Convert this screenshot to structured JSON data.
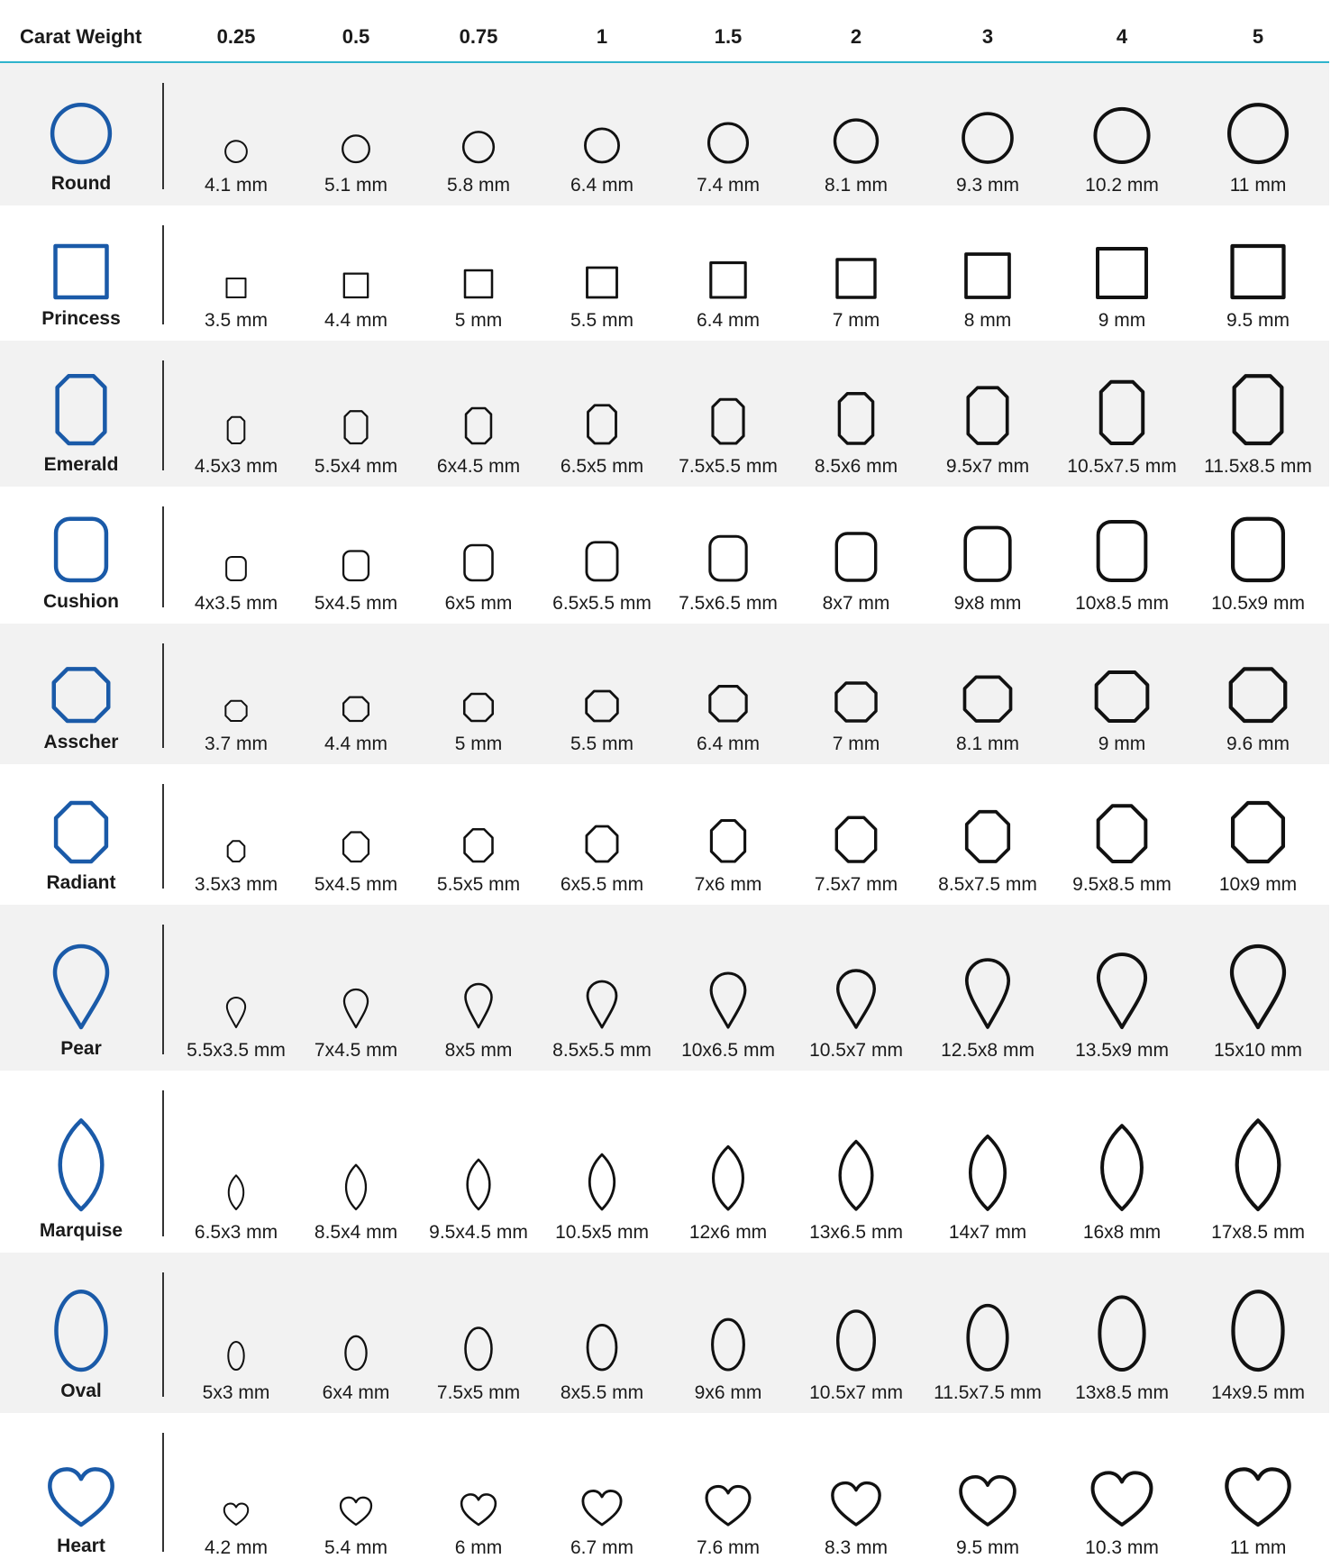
{
  "header": {
    "label": "Carat Weight",
    "carats": [
      "0.25",
      "0.5",
      "0.75",
      "1",
      "1.5",
      "2",
      "3",
      "4",
      "5"
    ]
  },
  "colors": {
    "accent": "#1a5aa8",
    "outline": "#111111",
    "rule": "#2fb3cc",
    "shade": "#f2f2f2"
  },
  "rows": [
    {
      "name": "Round",
      "icon": "round-shape-icon",
      "sizes": [
        "4.1 mm",
        "5.1 mm",
        "5.8 mm",
        "6.4 mm",
        "7.4 mm",
        "8.1 mm",
        "9.3 mm",
        "10.2 mm",
        "11 mm"
      ]
    },
    {
      "name": "Princess",
      "icon": "princess-shape-icon",
      "sizes": [
        "3.5 mm",
        "4.4 mm",
        "5 mm",
        "5.5 mm",
        "6.4 mm",
        "7 mm",
        "8 mm",
        "9 mm",
        "9.5 mm"
      ]
    },
    {
      "name": "Emerald",
      "icon": "emerald-shape-icon",
      "sizes": [
        "4.5x3 mm",
        "5.5x4 mm",
        "6x4.5 mm",
        "6.5x5 mm",
        "7.5x5.5 mm",
        "8.5x6 mm",
        "9.5x7 mm",
        "10.5x7.5 mm",
        "11.5x8.5 mm"
      ]
    },
    {
      "name": "Cushion",
      "icon": "cushion-shape-icon",
      "sizes": [
        "4x3.5 mm",
        "5x4.5 mm",
        "6x5 mm",
        "6.5x5.5 mm",
        "7.5x6.5 mm",
        "8x7 mm",
        "9x8 mm",
        "10x8.5 mm",
        "10.5x9 mm"
      ]
    },
    {
      "name": "Asscher",
      "icon": "asscher-shape-icon",
      "sizes": [
        "3.7 mm",
        "4.4 mm",
        "5 mm",
        "5.5 mm",
        "6.4 mm",
        "7 mm",
        "8.1 mm",
        "9 mm",
        "9.6 mm"
      ]
    },
    {
      "name": "Radiant",
      "icon": "radiant-shape-icon",
      "sizes": [
        "3.5x3 mm",
        "5x4.5 mm",
        "5.5x5 mm",
        "6x5.5 mm",
        "7x6 mm",
        "7.5x7 mm",
        "8.5x7.5 mm",
        "9.5x8.5 mm",
        "10x9 mm"
      ]
    },
    {
      "name": "Pear",
      "icon": "pear-shape-icon",
      "sizes": [
        "5.5x3.5 mm",
        "7x4.5 mm",
        "8x5 mm",
        "8.5x5.5 mm",
        "10x6.5 mm",
        "10.5x7 mm",
        "12.5x8 mm",
        "13.5x9 mm",
        "15x10 mm"
      ]
    },
    {
      "name": "Marquise",
      "icon": "marquise-shape-icon",
      "sizes": [
        "6.5x3 mm",
        "8.5x4 mm",
        "9.5x4.5 mm",
        "10.5x5 mm",
        "12x6 mm",
        "13x6.5 mm",
        "14x7 mm",
        "16x8 mm",
        "17x8.5 mm"
      ]
    },
    {
      "name": "Oval",
      "icon": "oval-shape-icon",
      "sizes": [
        "5x3 mm",
        "6x4 mm",
        "7.5x5 mm",
        "8x5.5 mm",
        "9x6 mm",
        "10.5x7 mm",
        "11.5x7.5 mm",
        "13x8.5 mm",
        "14x9.5 mm"
      ]
    },
    {
      "name": "Heart",
      "icon": "heart-shape-icon",
      "sizes": [
        "4.2 mm",
        "5.4 mm",
        "6 mm",
        "6.7 mm",
        "7.6 mm",
        "8.3 mm",
        "9.5 mm",
        "10.3 mm",
        "11 mm"
      ]
    }
  ]
}
